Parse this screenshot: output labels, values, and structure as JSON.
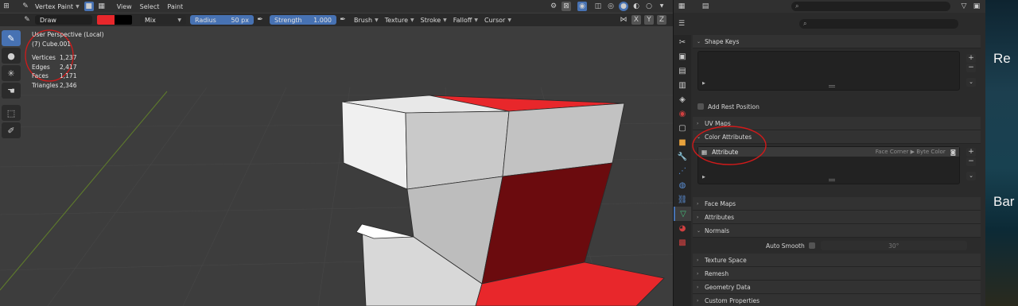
{
  "header": {
    "mode": "Vertex Paint",
    "menus": [
      "View",
      "Select",
      "Paint"
    ]
  },
  "toolsettings": {
    "brush": "Draw",
    "color": "#e8272b",
    "color2": "#000000",
    "blend": "Mix",
    "radius_label": "Radius",
    "radius_value": "50 px",
    "strength_label": "Strength",
    "strength_value": "1.000",
    "menus": [
      "Brush",
      "Texture",
      "Stroke",
      "Falloff",
      "Cursor"
    ],
    "axes": [
      "X",
      "Y",
      "Z"
    ]
  },
  "overlay": {
    "view": "User Perspective (Local)",
    "object": "(7) Cube.001",
    "stats": [
      {
        "k": "Vertices",
        "v": "1,237"
      },
      {
        "k": "Edges",
        "v": "2,417"
      },
      {
        "k": "Faces",
        "v": "1,171"
      },
      {
        "k": "Triangles",
        "v": "2,346"
      }
    ]
  },
  "properties": {
    "sections": {
      "shape_keys": "Shape Keys",
      "add_rest_position": "Add Rest Position",
      "uv_maps": "UV Maps",
      "color_attributes": "Color Attributes",
      "face_maps": "Face Maps",
      "attributes": "Attributes",
      "normals": "Normals",
      "texture_space": "Texture Space",
      "remesh": "Remesh",
      "geometry_data": "Geometry Data",
      "custom_properties": "Custom Properties"
    },
    "color_attribute": {
      "name": "Attribute",
      "domain": "Face Corner ▶ Byte Color"
    },
    "auto_smooth_label": "Auto Smooth",
    "auto_smooth_angle": "30°"
  },
  "wallpaper": {
    "text1": "Re",
    "text2": "Bar"
  },
  "colors": {
    "accent": "#4772b3",
    "paint_red": "#e8272b",
    "annotation_red": "#d11a1a"
  },
  "icons": [
    "brush-icon",
    "drop-icon",
    "sample-icon",
    "mask-icon",
    "cursor-box-icon",
    "annotate-icon",
    "search-icon",
    "filter-icon",
    "plus-icon",
    "minus-icon",
    "chevron-down-icon",
    "camera-icon"
  ]
}
